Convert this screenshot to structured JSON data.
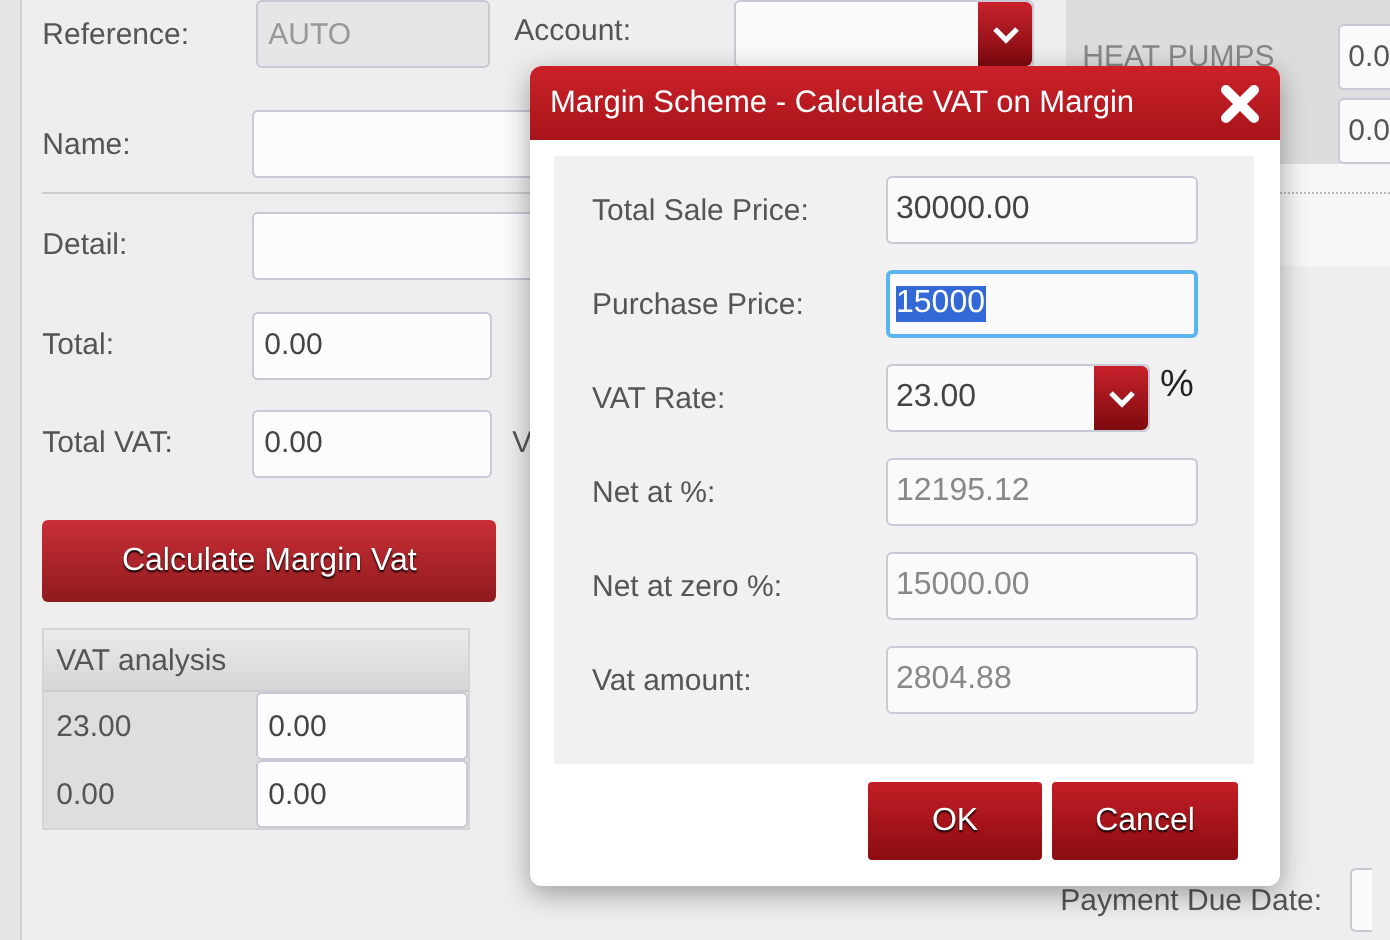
{
  "form": {
    "fields": [
      {
        "label": "Reference:",
        "value": "AUTO",
        "disabled": true
      },
      {
        "label": "Name:",
        "disabled": false
      },
      {
        "label": "Detail:",
        "disabled": false
      },
      {
        "label": "Total:",
        "value": "0.00",
        "disabled": false
      },
      {
        "label": "Total VAT:",
        "value": "0.00",
        "disabled": false
      }
    ],
    "account": {
      "label": "Account:"
    },
    "cut_label": "V",
    "calculate_button": "Calculate Margin Vat",
    "vat_analysis": {
      "title": "VAT analysis",
      "rows": [
        {
          "rate": "23.00",
          "amount": "0.00"
        },
        {
          "rate": "0.00",
          "amount": "0.00"
        }
      ]
    }
  },
  "side_panel": {
    "rows": [
      {
        "label": "HEAT PUMPS",
        "value": "0.0"
      },
      {
        "value": "0.0"
      }
    ]
  },
  "payment_due": {
    "label": "Payment Due Date:"
  },
  "dialog": {
    "title": "Margin Scheme - Calculate VAT on Margin",
    "fields": [
      {
        "label": "Total Sale Price:",
        "value": "30000.00",
        "kind": "input",
        "focused": false
      },
      {
        "label": "Purchase Price:",
        "value": "15000",
        "kind": "input",
        "focused": true
      },
      {
        "label": "VAT Rate:",
        "value": "23.00",
        "kind": "select",
        "unit": "%",
        "focused": false
      },
      {
        "label": "Net at %:",
        "value": "12195.12",
        "kind": "readonly",
        "focused": false
      },
      {
        "label": "Net at zero %:",
        "value": "15000.00",
        "kind": "readonly",
        "focused": false
      },
      {
        "label": "Vat amount:",
        "value": "2804.88",
        "kind": "readonly",
        "focused": false
      }
    ],
    "buttons": [
      "OK",
      "Cancel"
    ]
  }
}
